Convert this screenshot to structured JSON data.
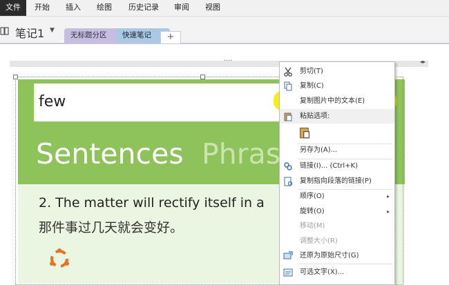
{
  "ribbon": {
    "file": "文件",
    "tabs": [
      "开始",
      "插入",
      "绘图",
      "历史记录",
      "审阅",
      "视图"
    ]
  },
  "notebook": {
    "name": "笔记1",
    "sections": [
      "无标题分区",
      "快速笔记"
    ],
    "add_label": "+"
  },
  "picture": {
    "search_word": "few",
    "title_main": "Sentences",
    "title_secondary": "Phras",
    "english": "2. The matter will rectify itself in a",
    "chinese": "那件事过几天就会变好。"
  },
  "page": {
    "handle_dots": "····",
    "collapse": "◂▸"
  },
  "context_menu": {
    "items": [
      {
        "label": "剪切(T)",
        "icon": "scissors-icon"
      },
      {
        "label": "复制(C)",
        "icon": "copy-icon"
      },
      {
        "label": "复制图片中的文本(E)",
        "icon": ""
      },
      {
        "label": "粘贴选项:",
        "icon": "paste-icon"
      },
      {
        "label": "",
        "icon": "paste-option-icon"
      },
      {
        "label": "另存为(A)...",
        "icon": ""
      },
      {
        "label": "链接(I)...  (Ctrl+K)",
        "icon": "link-icon"
      },
      {
        "label": "复制指向段落的链接(P)",
        "icon": "paragraph-link-icon"
      },
      {
        "label": "顺序(O)",
        "icon": ""
      },
      {
        "label": "旋转(O)",
        "icon": ""
      },
      {
        "label": "移动(M)",
        "icon": ""
      },
      {
        "label": "调整大小(R)",
        "icon": ""
      },
      {
        "label": "还原为原始尺寸(G)",
        "icon": "restore-size-icon"
      },
      {
        "label": "可选文字(X)...",
        "icon": "alt-text-icon"
      }
    ],
    "submenu_arrow": "▸",
    "highlight_color": "#f5ee00"
  },
  "colors": {
    "accent_green": "#8ec25b",
    "section1": "#c7bde3",
    "section2": "#a8c8e4",
    "logo_orange": "#e8731f"
  }
}
